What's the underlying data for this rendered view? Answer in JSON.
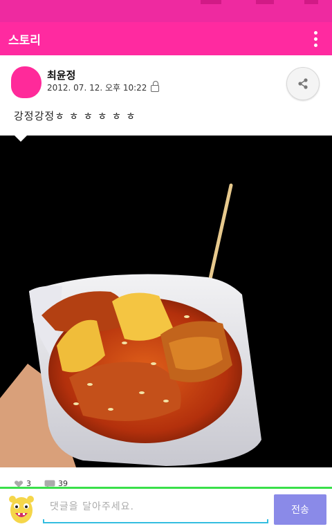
{
  "appbar": {
    "title": "스토리"
  },
  "post": {
    "author": "최윤정",
    "date": "2012. 07. 12. 오후 10:22",
    "text": "강정강정ㅎ ㅎ ㅎ ㅎ ㅎ ㅎ"
  },
  "stats": {
    "likes": "3",
    "comments": "39"
  },
  "comment_bar": {
    "placeholder": "댓글을 달아주세요.",
    "send_label": "전송"
  },
  "colors": {
    "brand": "#ff2aa0",
    "send": "#8a8ae8",
    "divider": "#39e04a"
  },
  "icons": [
    "overflow-menu-icon",
    "lock-icon",
    "share-icon",
    "heart-icon",
    "comment-icon",
    "mascot-icon"
  ]
}
